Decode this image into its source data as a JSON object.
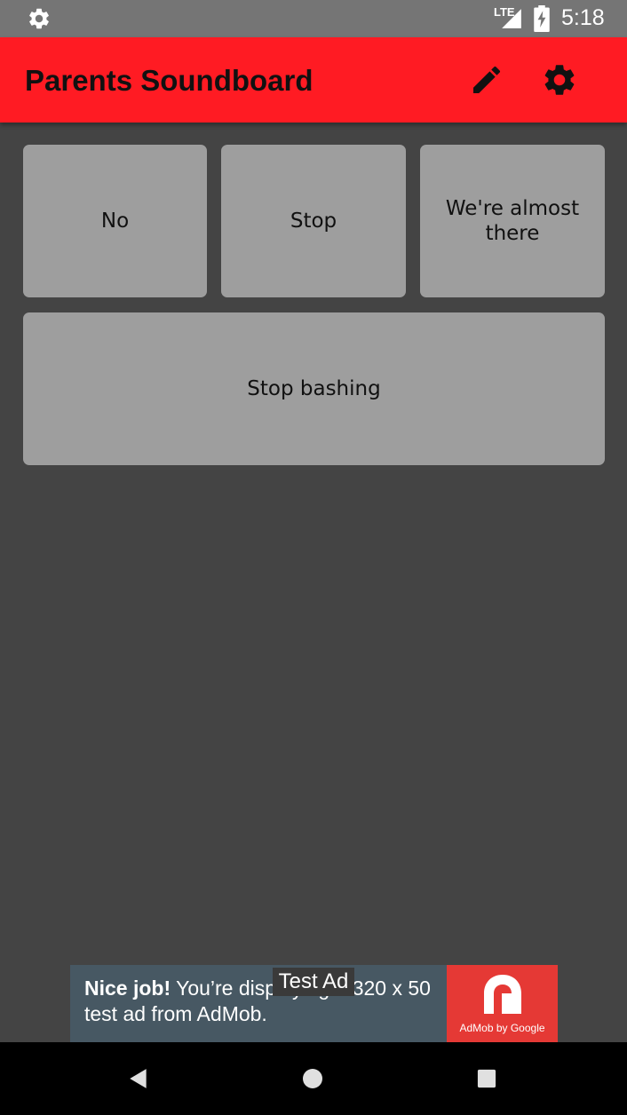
{
  "status_bar": {
    "network": "LTE",
    "time": "5:18",
    "icons": [
      "settings-gear-icon",
      "signal-icon",
      "battery-charging-icon"
    ]
  },
  "app_bar": {
    "title": "Parents Soundboard",
    "actions": [
      "edit-pencil-icon",
      "settings-gear-icon"
    ],
    "background_color": "#ff1b23"
  },
  "sounds": [
    {
      "label": "No"
    },
    {
      "label": "Stop"
    },
    {
      "label": "We're almost there"
    },
    {
      "label": "Stop bashing"
    }
  ],
  "ad_banner": {
    "headline": "Nice job!",
    "body": " You’re displaying a 320 x 50 test ad from AdMob.",
    "badge": "Test Ad",
    "brand": "AdMob by Google",
    "background_color": "#475863",
    "logo_color": "#e53935"
  },
  "nav_bar": {
    "buttons": [
      "back-icon",
      "home-icon",
      "recents-icon"
    ]
  }
}
